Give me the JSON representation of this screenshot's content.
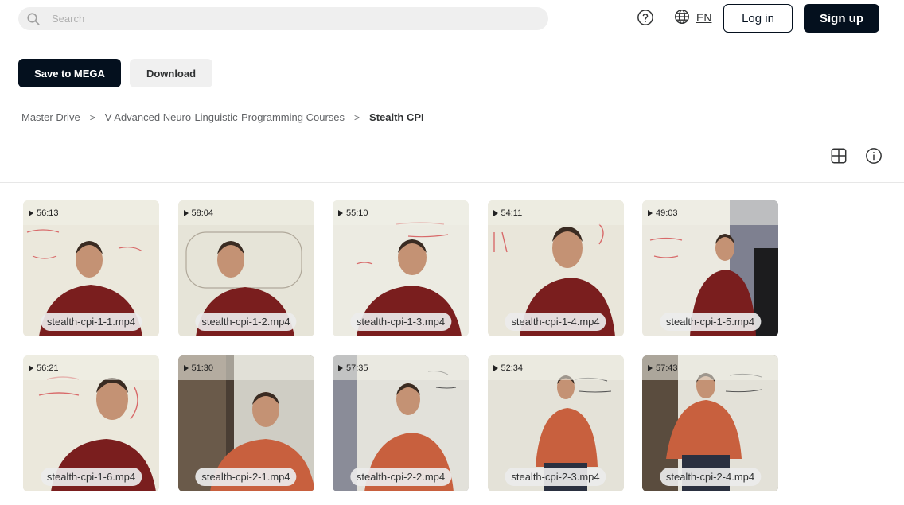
{
  "header": {
    "search_placeholder": "Search",
    "language": "EN",
    "login_label": "Log in",
    "signup_label": "Sign up"
  },
  "actions": {
    "save_label": "Save to MEGA",
    "download_label": "Download"
  },
  "breadcrumb": [
    "Master Drive",
    "V Advanced Neuro-Linguistic-Programming Courses",
    "Stealth CPI"
  ],
  "icons": {
    "search": "search-icon",
    "help": "help-icon",
    "globe": "globe-icon",
    "grid_view": "grid-view-icon",
    "info": "info-icon",
    "play": "play-icon"
  },
  "colors": {
    "primary": "#04101e",
    "search_bg": "#efefef",
    "secondary_btn": "#f0f0f0",
    "shirt_dark": "#7a1e1e",
    "shirt_orange": "#c8603e"
  },
  "files": [
    {
      "name": "stealth-cpi-1-1.mp4",
      "duration": "56:13"
    },
    {
      "name": "stealth-cpi-1-2.mp4",
      "duration": "58:04"
    },
    {
      "name": "stealth-cpi-1-3.mp4",
      "duration": "55:10"
    },
    {
      "name": "stealth-cpi-1-4.mp4",
      "duration": "54:11"
    },
    {
      "name": "stealth-cpi-1-5.mp4",
      "duration": "49:03"
    },
    {
      "name": "stealth-cpi-1-6.mp4",
      "duration": "56:21"
    },
    {
      "name": "stealth-cpi-2-1.mp4",
      "duration": "51:30"
    },
    {
      "name": "stealth-cpi-2-2.mp4",
      "duration": "57:35"
    },
    {
      "name": "stealth-cpi-2-3.mp4",
      "duration": "52:34"
    },
    {
      "name": "stealth-cpi-2-4.mp4",
      "duration": "57:43"
    }
  ]
}
